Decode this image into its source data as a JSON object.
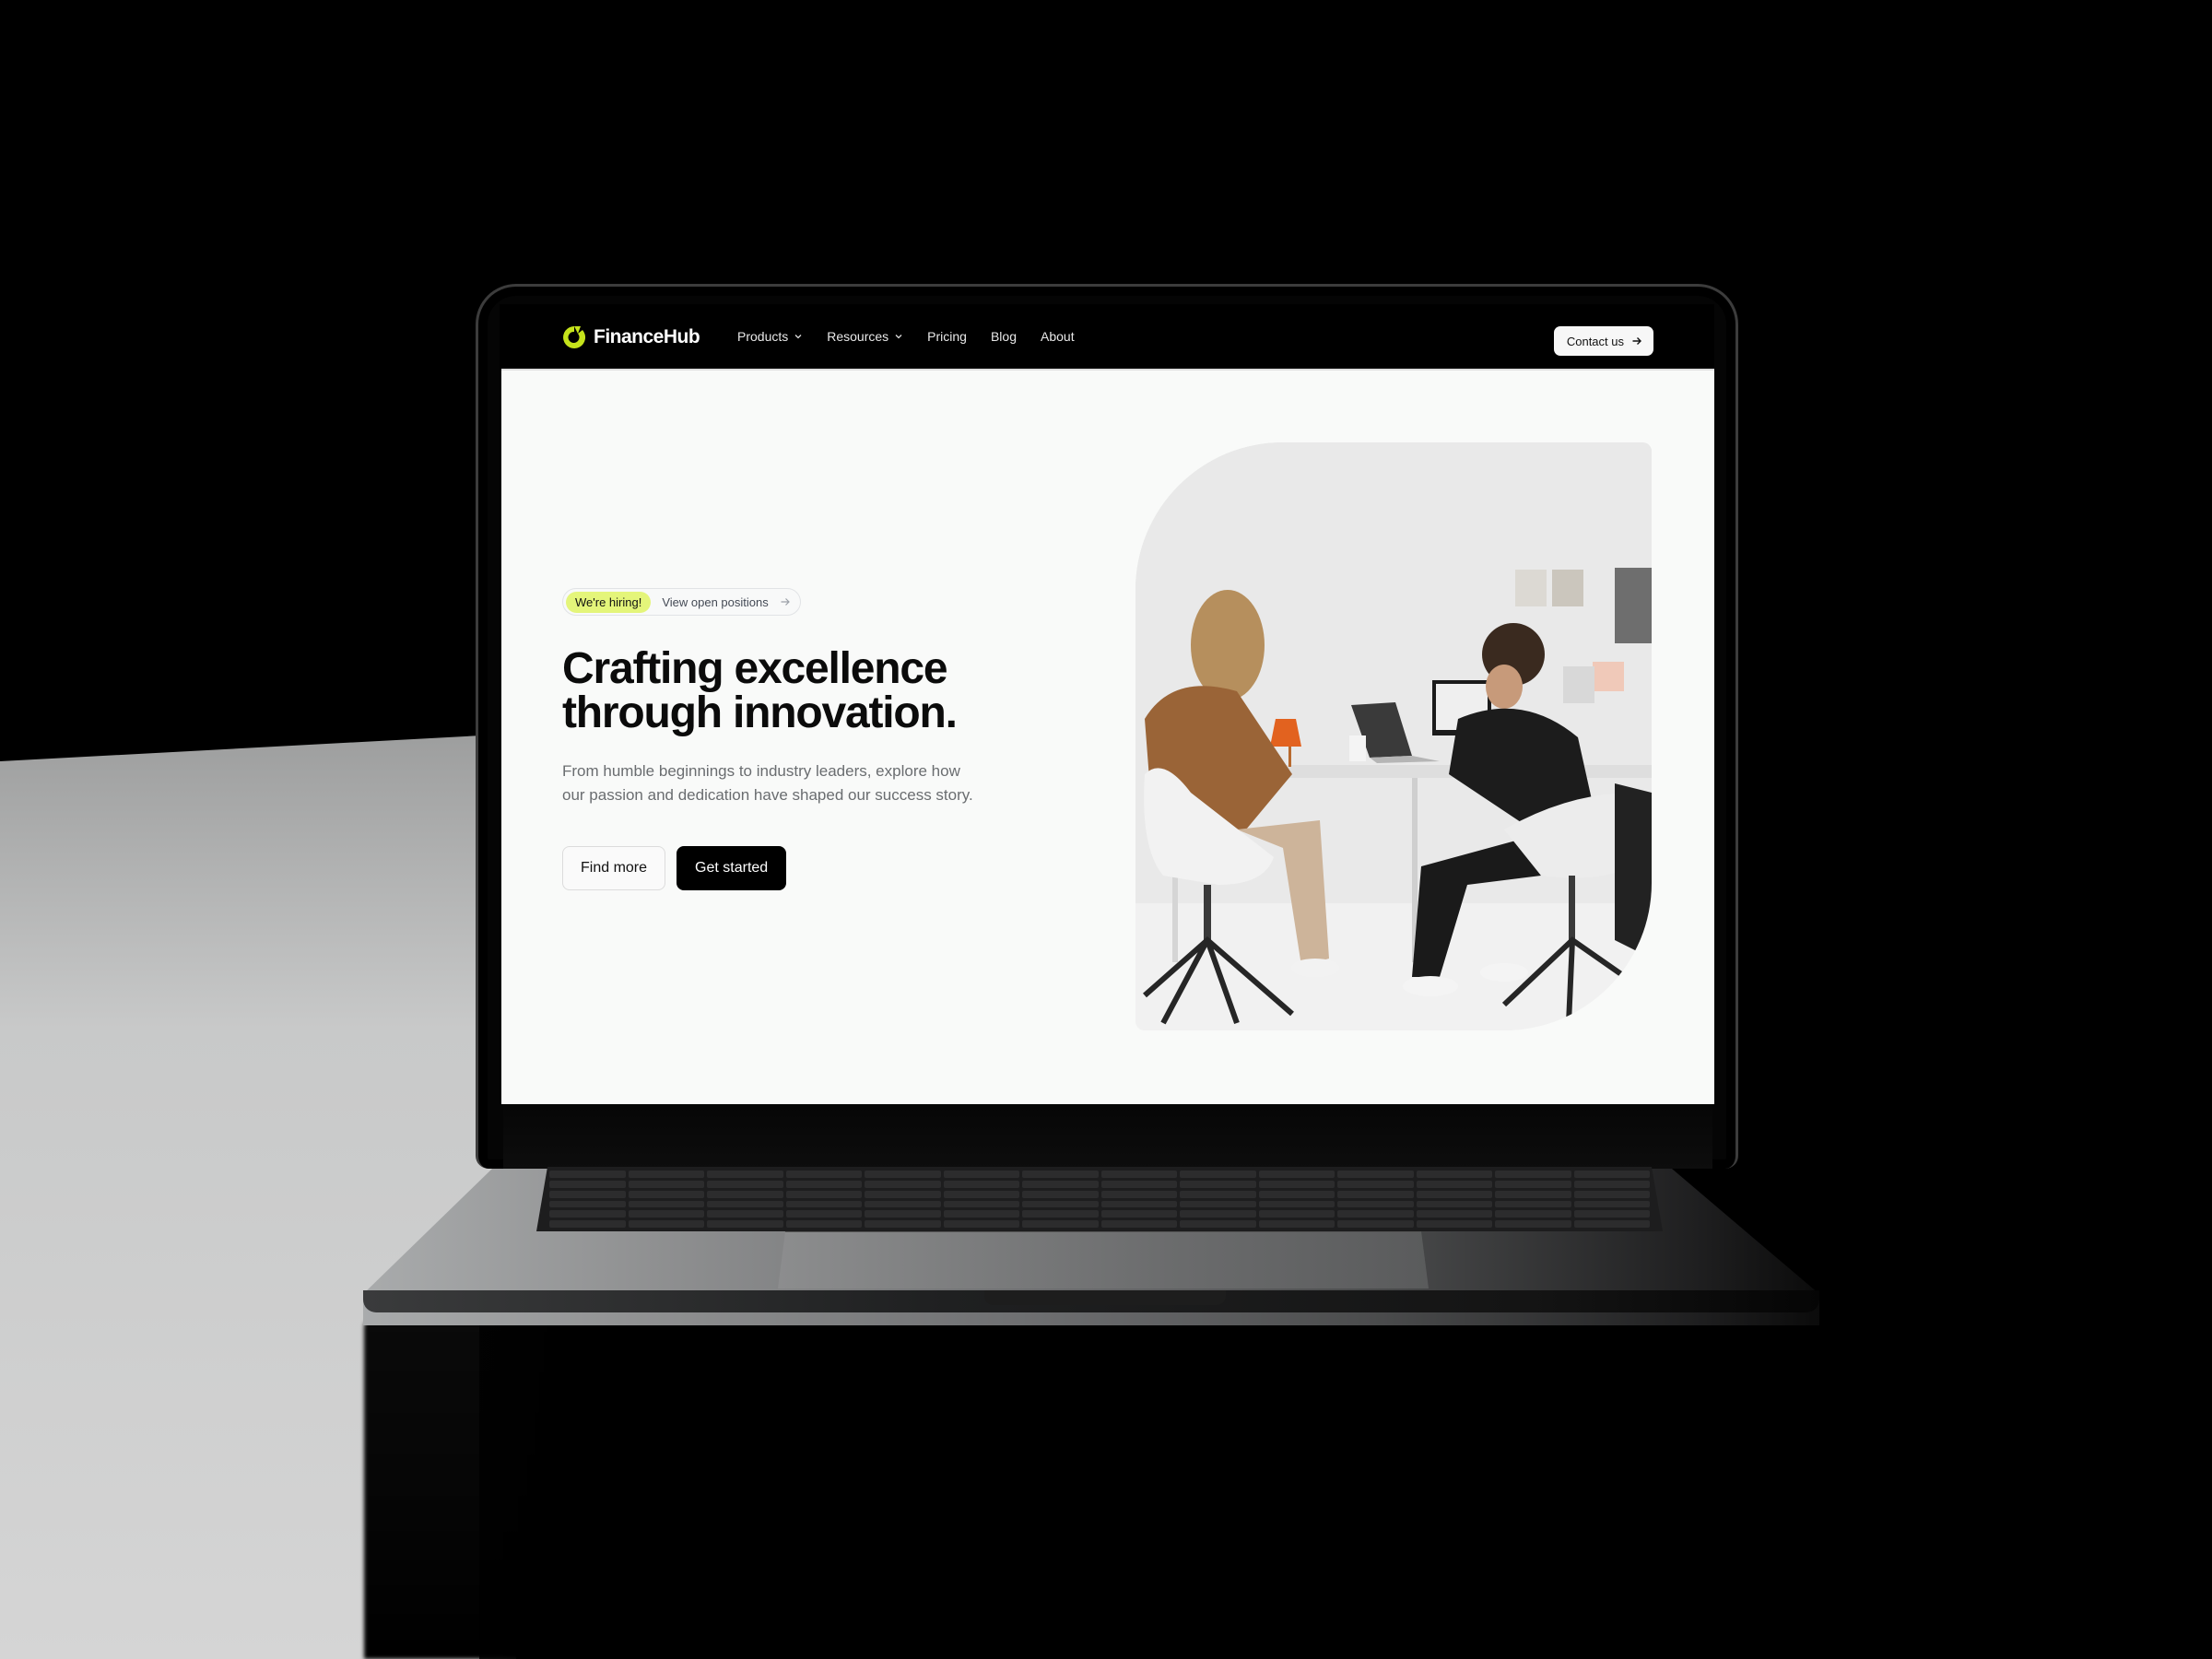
{
  "brand": {
    "name": "FinanceHub",
    "accent_color": "#c5e31b",
    "logo_icon": "ring-logo-icon"
  },
  "nav": {
    "items": [
      {
        "label": "Products",
        "has_dropdown": true
      },
      {
        "label": "Resources",
        "has_dropdown": true
      },
      {
        "label": "Pricing",
        "has_dropdown": false
      },
      {
        "label": "Blog",
        "has_dropdown": false
      },
      {
        "label": "About",
        "has_dropdown": false
      }
    ],
    "cta": {
      "label": "Contact us",
      "icon": "arrow-right-icon"
    }
  },
  "hero": {
    "badge": {
      "label": "We're hiring!",
      "color": "#e4f57a"
    },
    "badge_link": {
      "label": "View open positions",
      "icon": "arrow-right-icon"
    },
    "title_line1": "Crafting excellence",
    "title_line2": "through innovation.",
    "subtitle_line1": "From humble beginnings to industry leaders, explore how",
    "subtitle_line2": "our passion and dedication have shaped our success story.",
    "buttons": {
      "secondary": "Find more",
      "primary": "Get started"
    },
    "image_alt": "Two colleagues working at a shared desk with laptops in a bright office"
  },
  "colors": {
    "page_background": "#f9faf9",
    "nav_background": "#000000",
    "primary_button": "#000000",
    "text_primary": "#0b0b0b",
    "text_muted": "#6a6d70"
  }
}
